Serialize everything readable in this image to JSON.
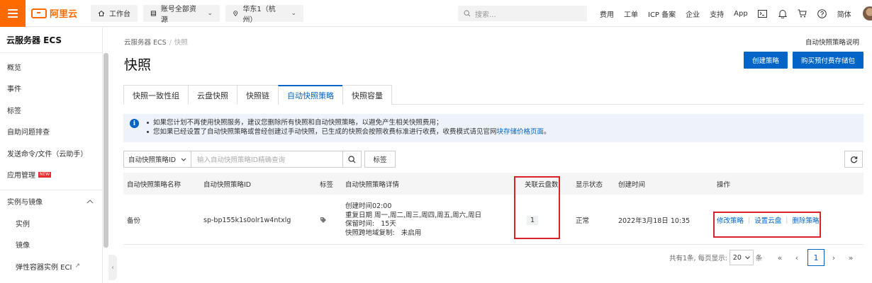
{
  "topbar": {
    "logo": "阿里云",
    "workbench": "工作台",
    "account_scope": "账号全部资源",
    "region": "华东1（杭州）",
    "search_placeholder": "搜索...",
    "links": [
      "费用",
      "工单",
      "ICP 备案",
      "企业",
      "支持",
      "App"
    ],
    "language": "简体",
    "brand_color": "#ff6a00"
  },
  "sidebar": {
    "title": "云服务器 ECS",
    "items": [
      "概览",
      "事件",
      "标签",
      "自助问题排查",
      "发送命令/文件（云助手）",
      "应用管理"
    ],
    "new_badge": "NEW",
    "group": "实例与镜像",
    "sub_items": [
      "实例",
      "镜像",
      "弹性容器实例 ECI"
    ]
  },
  "breadcrumb": {
    "root": "云服务器 ECS",
    "current": "快照"
  },
  "help_link": "自动快照策略说明",
  "page_title": "快照",
  "buttons": {
    "create_policy": "创建策略",
    "buy_storage": "购买预付费存储包"
  },
  "tabs": [
    "快照一致性组",
    "云盘快照",
    "快照链",
    "自动快照策略",
    "快照容量"
  ],
  "active_tab": 3,
  "notice": {
    "line1": "如果您计划不再使用快照服务，建议您删除所有快照和自动快照策略，以避免产生相关快照费用；",
    "line2_prefix": "您如果已经设置了自动快照策略或曾经创建过手动快照，已生成的快照会按照收费标准进行收费，收费模式请见官网",
    "line2_link": "块存储价格页面",
    "line2_suffix": "。"
  },
  "filter": {
    "select_value": "自动快照策略ID",
    "input_placeholder": "输入自动快照策略ID精确查询",
    "tag_button": "标签"
  },
  "table": {
    "headers": [
      "自动快照策略名称",
      "自动快照策略ID",
      "标签",
      "自动快照策略详情",
      "关联云盘数",
      "显示状态",
      "创建时间",
      "操作"
    ],
    "row": {
      "name": "备份",
      "id": "sp-bp155k1s0olr1w4ntxlg",
      "details": [
        "创建时间02:00",
        "重复日期 周一,周二,周三,周四,周五,周六,周日",
        "保留时间:   15天",
        "快照跨地域复制:   未启用"
      ],
      "disk_count": "1",
      "status": "正常",
      "created": "2022年3月18日 10:35",
      "actions": [
        "修改策略",
        "设置云盘",
        "删除策略"
      ]
    }
  },
  "pagination": {
    "summary": "共有1条, 每页显示:",
    "page_size": "20",
    "unit": "条",
    "current_page": "1"
  }
}
